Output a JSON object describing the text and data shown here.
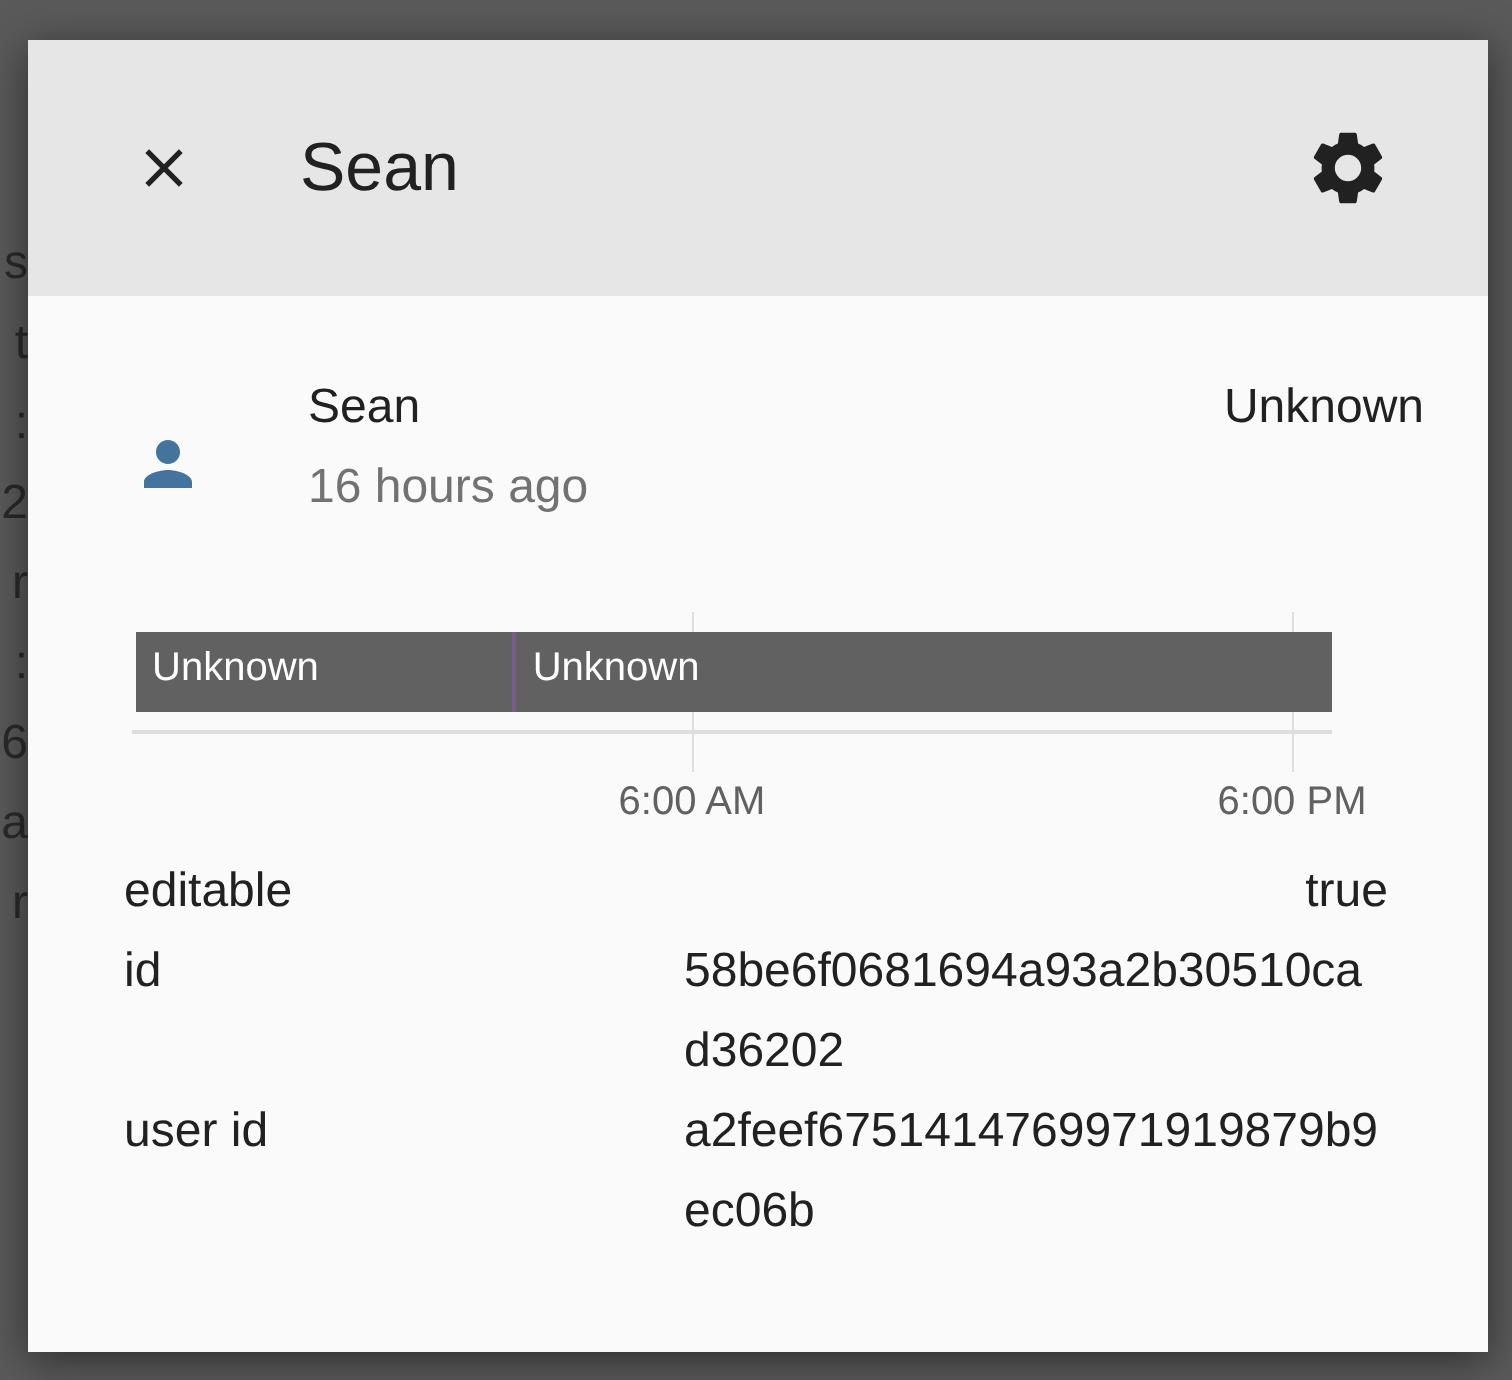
{
  "backdrop_fragments": [
    "s",
    "t",
    ":",
    "2",
    "r",
    ":",
    "6",
    "a",
    "r"
  ],
  "dialog": {
    "title": "Sean",
    "entity": {
      "name": "Sean",
      "last_changed": "16 hours ago",
      "state": "Unknown"
    },
    "timeline": {
      "segments": [
        {
          "label": "Unknown",
          "level": 0.315
        },
        {
          "label": "Unknown"
        }
      ],
      "ticks": [
        "6:00 AM",
        "6:00 PM"
      ]
    },
    "attributes": [
      {
        "key": "editable",
        "value": "true"
      },
      {
        "key": "id",
        "value": "58be6f0681694a93a2b30510cad36202"
      },
      {
        "key": "user id",
        "value": "a2feef6751414769971919879b9ec06b"
      }
    ]
  }
}
